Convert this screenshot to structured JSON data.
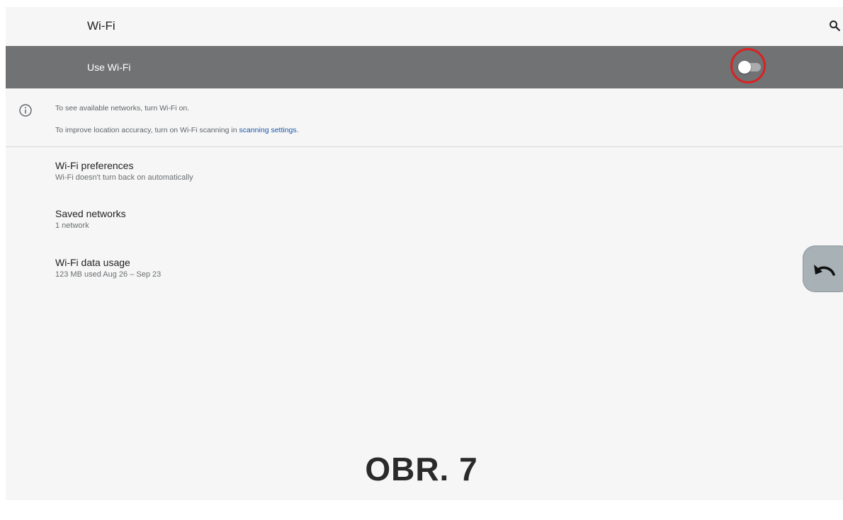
{
  "appbar": {
    "title": "Wi-Fi",
    "search_icon": "search-icon"
  },
  "master_switch": {
    "label": "Use Wi-Fi",
    "state": "off",
    "highlight_color": "#d82323"
  },
  "info": {
    "icon": "info-icon",
    "line1": "To see available networks, turn Wi-Fi on.",
    "line2_prefix": "To improve location accuracy, turn on Wi-Fi scanning in ",
    "line2_link": "scanning settings",
    "line2_suffix": "."
  },
  "preferences": [
    {
      "title": "Wi-Fi preferences",
      "subtitle": "Wi-Fi doesn't turn back on automatically"
    },
    {
      "title": "Saved networks",
      "subtitle": "1 network"
    },
    {
      "title": "Wi-Fi data usage",
      "subtitle": "123 MB used Aug 26 – Sep 23"
    }
  ],
  "floating_button": {
    "icon": "undo-icon"
  },
  "caption": "OBR. 7",
  "colors": {
    "switch_bar": "#707274",
    "background": "#f6f6f6",
    "link": "#1a56a8"
  }
}
